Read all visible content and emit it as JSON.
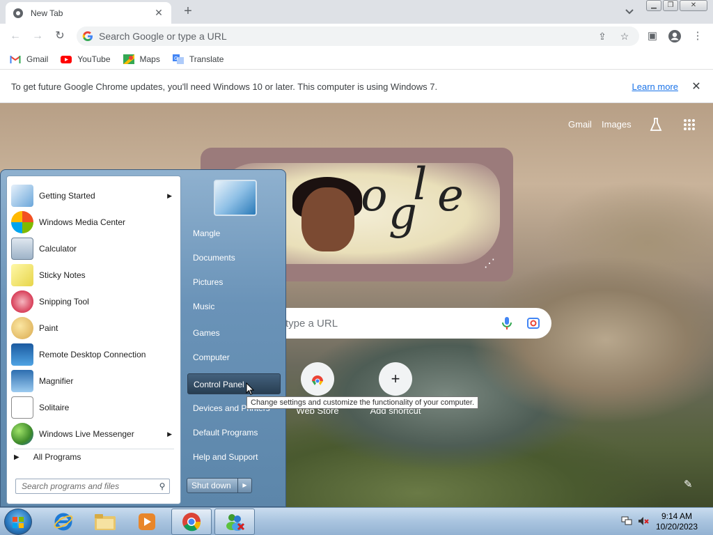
{
  "browser": {
    "tab_title": "New Tab",
    "omnibox_placeholder": "Search Google or type a URL",
    "bookmarks": [
      {
        "label": "Gmail",
        "icon": "gmail-icon"
      },
      {
        "label": "YouTube",
        "icon": "youtube-icon"
      },
      {
        "label": "Maps",
        "icon": "maps-icon"
      },
      {
        "label": "Translate",
        "icon": "translate-icon"
      }
    ],
    "infobar": {
      "message": "To get future Google Chrome updates, you'll need Windows 10 or later. This computer is using Windows 7.",
      "link": "Learn more"
    }
  },
  "newtab": {
    "top_links": [
      "Gmail",
      "Images"
    ],
    "search_placeholder": "type a URL",
    "shortcuts": [
      "Web Store",
      "Add shortcut"
    ]
  },
  "start_menu": {
    "programs": [
      {
        "label": "Getting Started",
        "submenu": true,
        "icon": "getting-started-icon"
      },
      {
        "label": "Windows Media Center",
        "submenu": false,
        "icon": "media-center-icon"
      },
      {
        "label": "Calculator",
        "submenu": false,
        "icon": "calculator-icon"
      },
      {
        "label": "Sticky Notes",
        "submenu": false,
        "icon": "sticky-notes-icon"
      },
      {
        "label": "Snipping Tool",
        "submenu": false,
        "icon": "snipping-tool-icon"
      },
      {
        "label": "Paint",
        "submenu": false,
        "icon": "paint-icon"
      },
      {
        "label": "Remote Desktop Connection",
        "submenu": false,
        "icon": "remote-desktop-icon"
      },
      {
        "label": "Magnifier",
        "submenu": false,
        "icon": "magnifier-icon"
      },
      {
        "label": "Solitaire",
        "submenu": false,
        "icon": "solitaire-icon"
      },
      {
        "label": "Windows Live Messenger",
        "submenu": true,
        "icon": "messenger-icon"
      }
    ],
    "all_programs": "All Programs",
    "search_placeholder": "Search programs and files",
    "right_items": [
      "Mangle",
      "Documents",
      "Pictures",
      "Music",
      "Games",
      "Computer",
      "Control Panel",
      "Devices and Printers",
      "Default Programs",
      "Help and Support"
    ],
    "shutdown": "Shut down",
    "tooltip": "Change settings and customize the functionality of your computer."
  },
  "taskbar": {
    "time": "9:14 AM",
    "date": "10/20/2023"
  }
}
